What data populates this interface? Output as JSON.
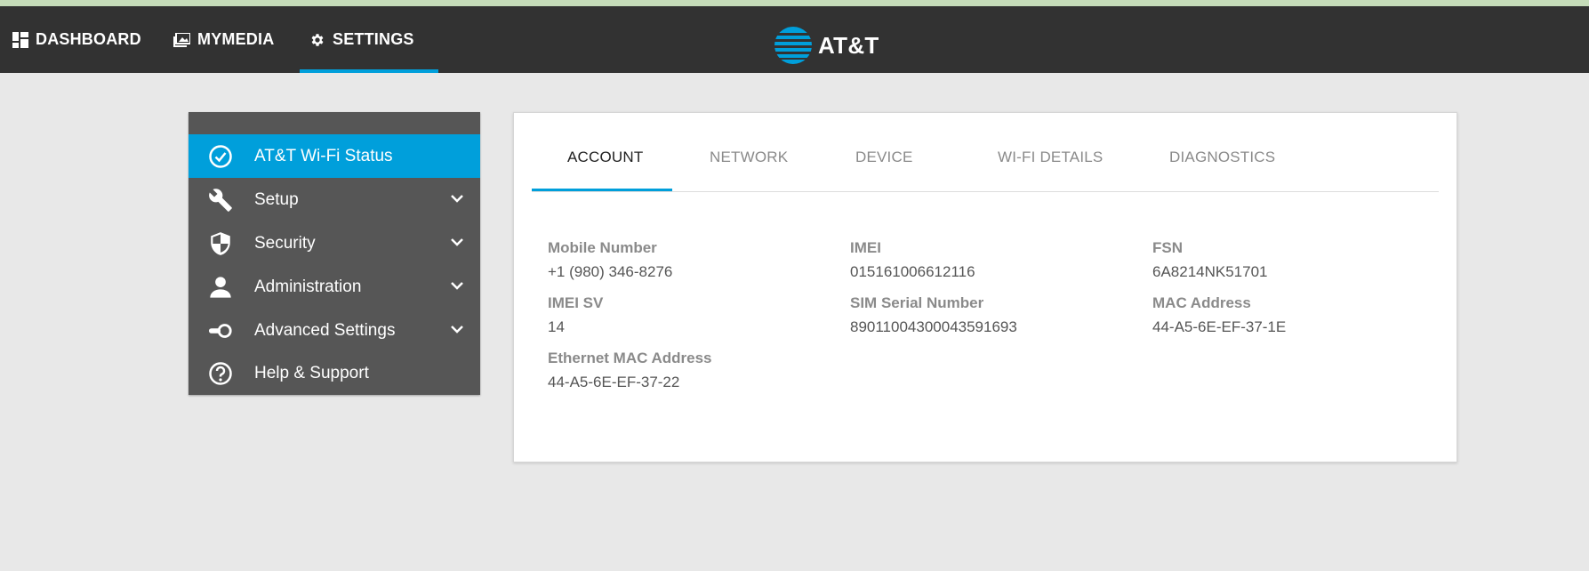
{
  "nav": {
    "dashboard": "DASHBOARD",
    "mymedia": "MYMEDIA",
    "settings": "SETTINGS",
    "brand": "AT&T"
  },
  "sidebar": {
    "items": [
      {
        "label": "AT&T Wi-Fi Status",
        "icon": "check-circle-icon",
        "active": true
      },
      {
        "label": "Setup",
        "icon": "wrench-icon"
      },
      {
        "label": "Security",
        "icon": "shield-icon"
      },
      {
        "label": "Administration",
        "icon": "person-icon"
      },
      {
        "label": "Advanced Settings",
        "icon": "toggle-icon"
      },
      {
        "label": "Help & Support",
        "icon": "question-circle-icon"
      }
    ]
  },
  "tabs": [
    "ACCOUNT",
    "NETWORK",
    "DEVICE",
    "WI-FI DETAILS",
    "DIAGNOSTICS"
  ],
  "fields": {
    "mobile_number": {
      "label": "Mobile Number",
      "value": "+1 (980) 346-8276"
    },
    "imei": {
      "label": "IMEI",
      "value": "015161006612116"
    },
    "fsn": {
      "label": "FSN",
      "value": "6A8214NK51701"
    },
    "imei_sv": {
      "label": "IMEI SV",
      "value": "14"
    },
    "sim_serial": {
      "label": "SIM Serial Number",
      "value": "89011004300043591693"
    },
    "mac_address": {
      "label": "MAC Address",
      "value": "44-A5-6E-EF-37-1E"
    },
    "ethernet_mac": {
      "label": "Ethernet MAC Address",
      "value": "44-A5-6E-EF-37-22"
    }
  },
  "colors": {
    "accent": "#009fdb",
    "topbar": "#323232",
    "sidebar": "#565656",
    "background": "#e8e8e8"
  }
}
